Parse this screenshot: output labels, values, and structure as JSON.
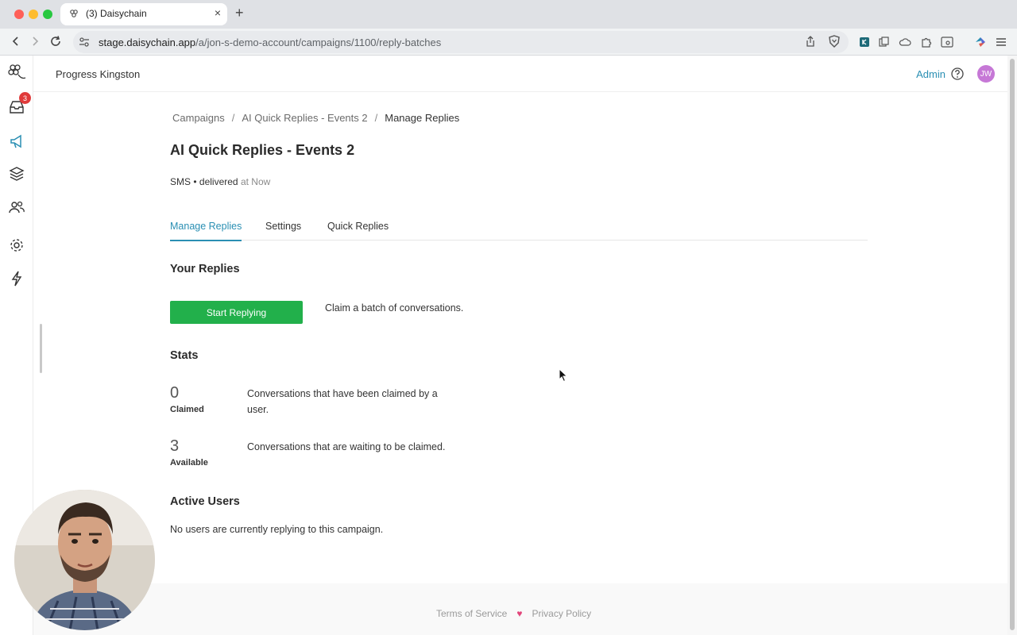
{
  "browser": {
    "tab_title": "(3) Daisychain",
    "new_tab": "+",
    "tab_close": "×",
    "url_domain": "stage.daisychain.app",
    "url_path": "/a/jon-s-demo-account/campaigns/1100/reply-batches"
  },
  "app": {
    "org_name": "Progress Kingston",
    "admin_label": "Admin",
    "user_initials": "JW",
    "inbox_badge": "3",
    "accent": "#2a8fb3"
  },
  "breadcrumb": {
    "items": [
      "Campaigns",
      "AI Quick Replies - Events 2",
      "Manage Replies"
    ]
  },
  "page": {
    "title": "AI Quick Replies - Events 2",
    "channel": "SMS",
    "status": "delivered",
    "status_time": "at Now"
  },
  "tabs": [
    "Manage Replies",
    "Settings",
    "Quick Replies"
  ],
  "your_replies": {
    "heading": "Your Replies",
    "button_label": "Start Replying",
    "button_color": "#22b04b",
    "description": "Claim a batch of conversations."
  },
  "stats": {
    "heading": "Stats",
    "items": [
      {
        "value": "0",
        "label": "Claimed",
        "description": "Conversations that have been claimed by a user."
      },
      {
        "value": "3",
        "label": "Available",
        "description": "Conversations that are waiting to be claimed."
      }
    ]
  },
  "active_users": {
    "heading": "Active Users",
    "empty_text": "No users are currently replying to this campaign."
  },
  "footer": {
    "terms": "Terms of Service",
    "privacy": "Privacy Policy"
  }
}
